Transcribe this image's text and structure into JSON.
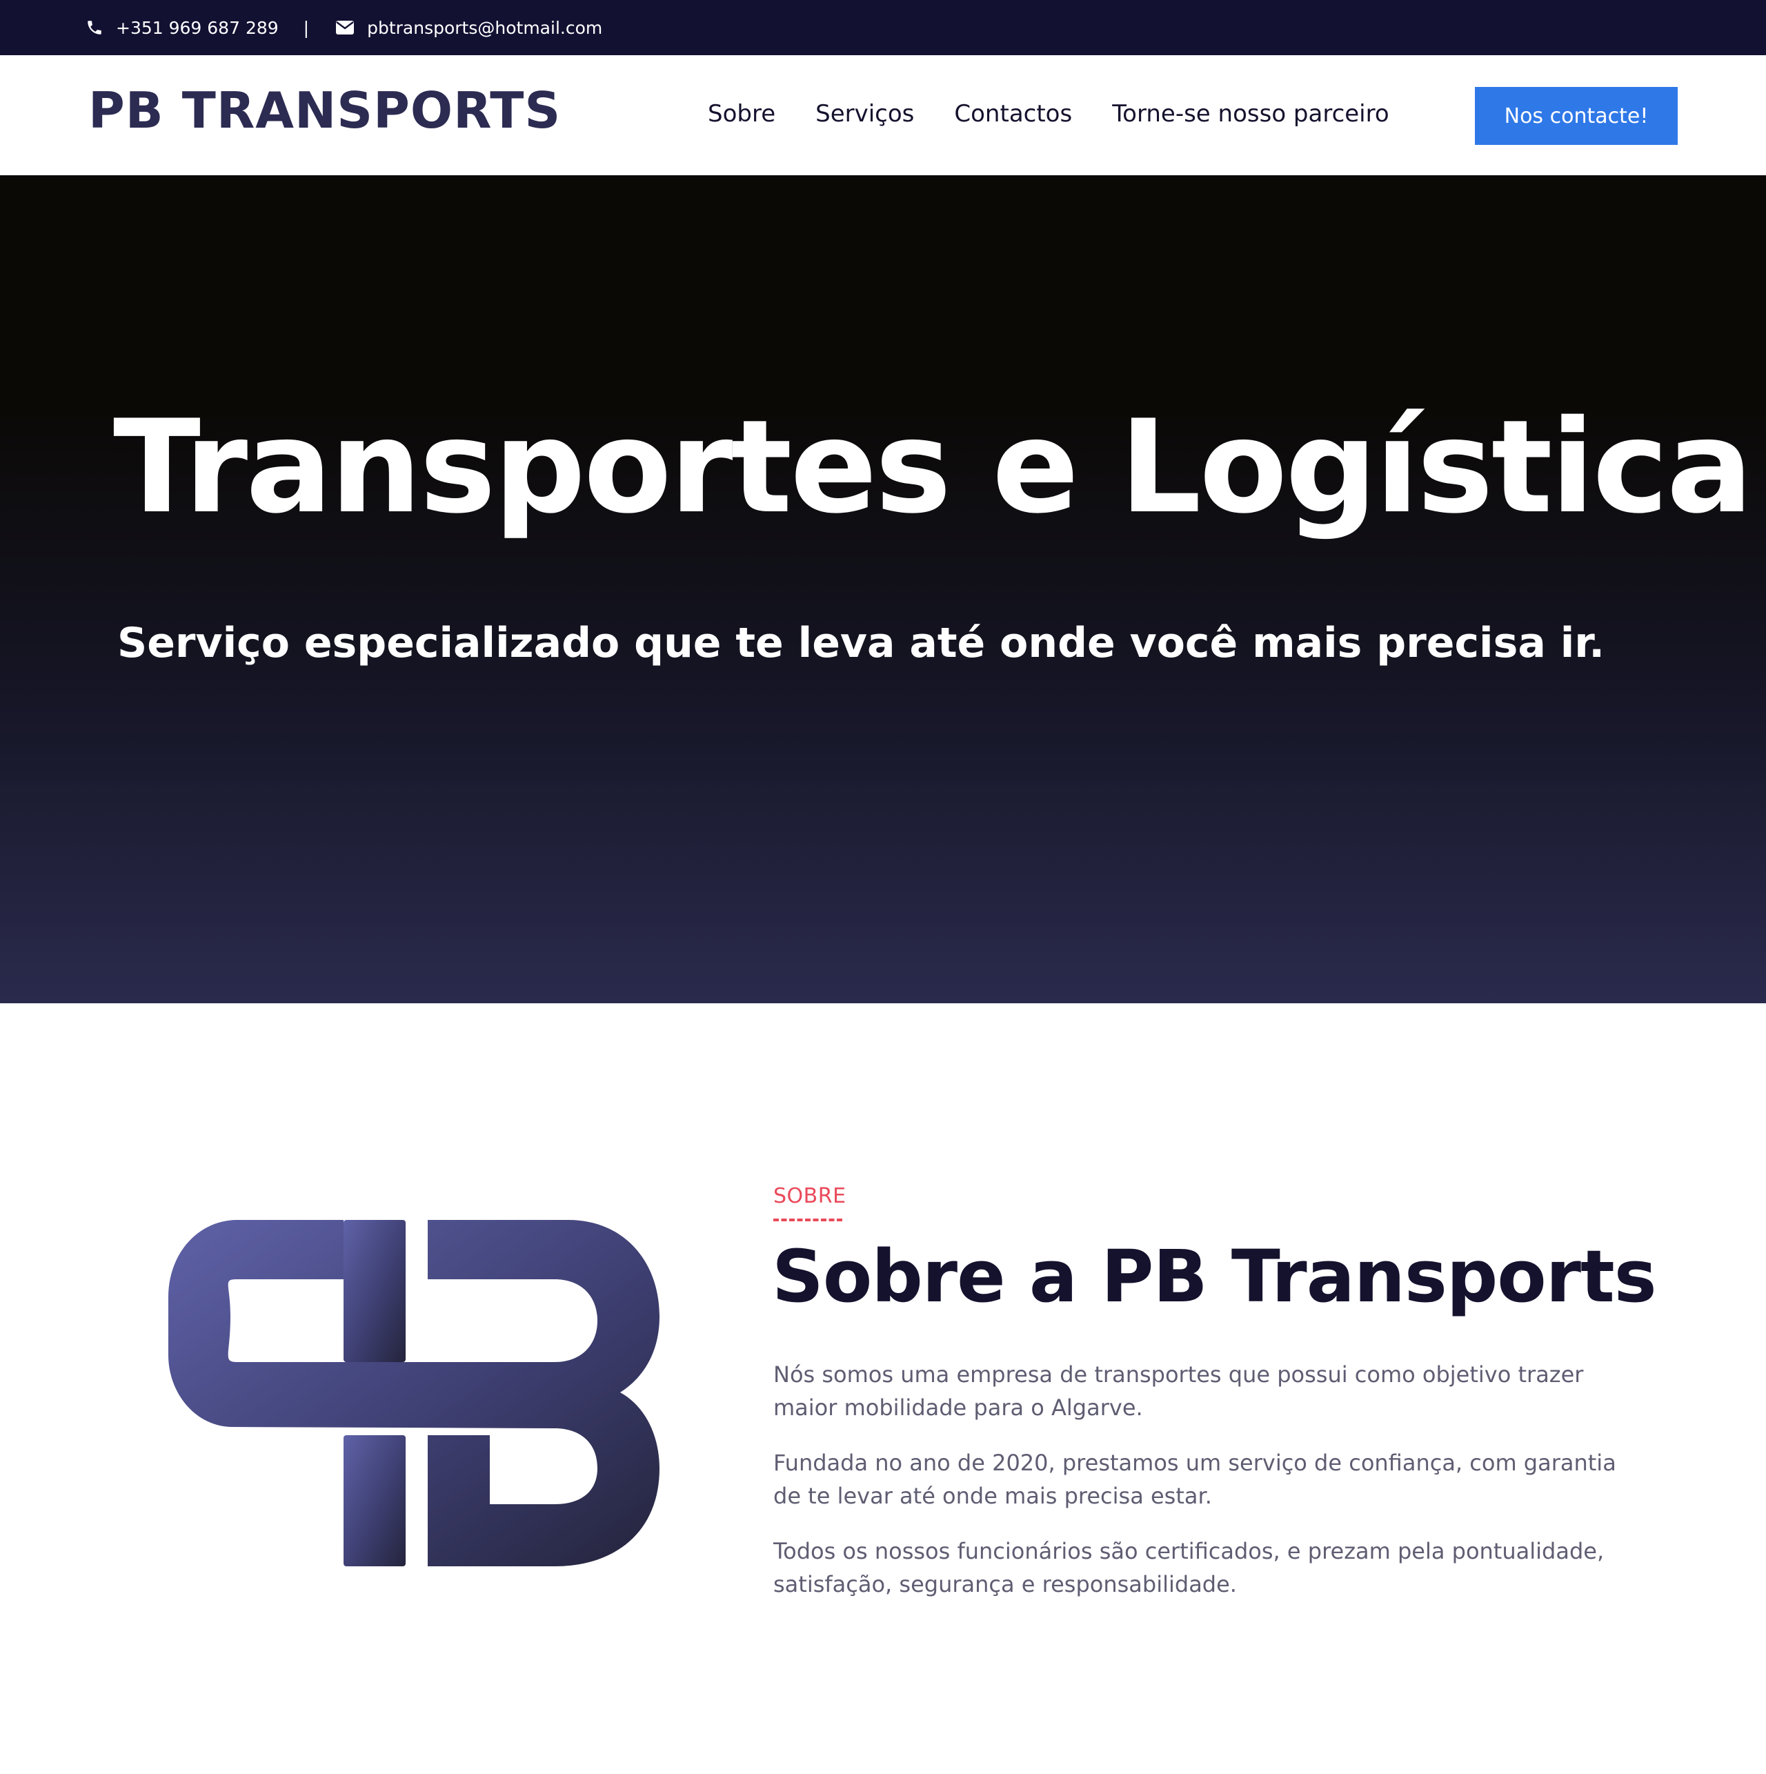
{
  "topbar": {
    "phone": "+351 969 687 289",
    "separator": "|",
    "email": "pbtransports@hotmail.com",
    "icons": [
      "phone-icon",
      "envelope-icon"
    ]
  },
  "header": {
    "logo": "PB TRANSPORTS",
    "nav": [
      "Sobre",
      "Serviços",
      "Contactos",
      "Torne-se nosso parceiro"
    ],
    "cta": "Nos contacte!"
  },
  "hero": {
    "title": "Transportes e Logística",
    "subtitle": "Serviço especializado que te leva até onde você mais precisa ir."
  },
  "about": {
    "kicker": "SOBRE",
    "title": "Sobre a PB Transports",
    "paragraphs": [
      "Nós somos uma empresa de transportes que possui como objetivo trazer maior mobilidade para o Algarve.",
      "Fundada no ano de 2020, prestamos um serviço de confiança, com garantia de te levar até onde mais precisa estar.",
      "Todos os nossos funcionários são certificados, e prezam pela pontualidade, satisfação, segurança e responsabilidade."
    ]
  },
  "colors": {
    "topbar_bg": "#121132",
    "accent_blue": "#2f78e8",
    "kicker_red": "#e94a5a",
    "logo_navy": "#2c2b52",
    "logo_gradient_start": "#5a5c9c",
    "logo_gradient_end": "#26263f"
  }
}
